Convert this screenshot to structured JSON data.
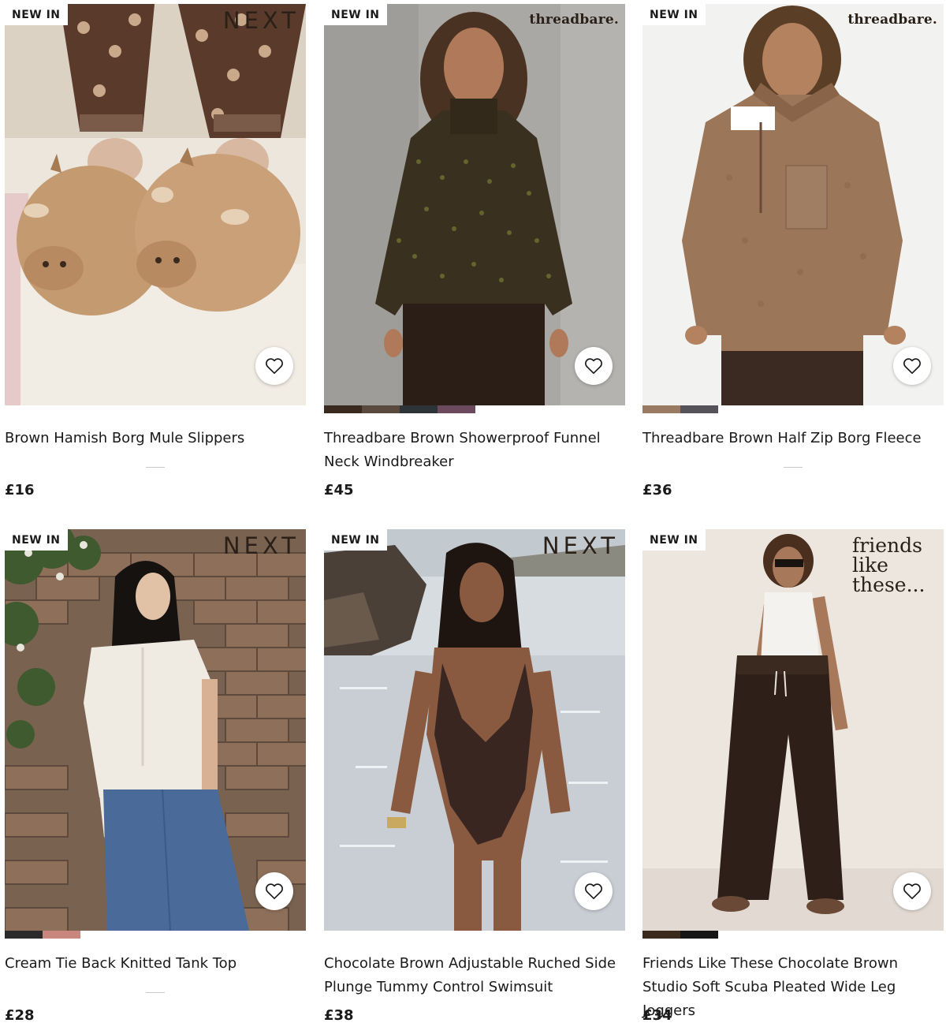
{
  "products": [
    {
      "badge": "NEW IN",
      "brand": "NEXT",
      "title": "Brown Hamish Borg Mule Slippers",
      "price": "£16",
      "image_desc_icon": "slippers-image",
      "swatches": []
    },
    {
      "badge": "NEW IN",
      "brand": "threadbare.",
      "title": "Threadbare Brown Showerproof Funnel Neck Windbreaker",
      "price": "£45",
      "image_desc_icon": "jacket-image",
      "swatches": [
        "#3a2a1e",
        "#5a4a3e",
        "#2c3438",
        "#6b4a5e"
      ]
    },
    {
      "badge": "NEW IN",
      "brand": "threadbare.",
      "title": "Threadbare Brown Half Zip Borg Fleece",
      "price": "£36",
      "image_desc_icon": "fleece-image",
      "swatches": [
        "#9a7a62",
        "#55525a"
      ]
    },
    {
      "badge": "NEW IN",
      "brand": "NEXT",
      "title": "Cream Tie Back Knitted Tank Top",
      "price": "£28",
      "image_desc_icon": "knit-top-image",
      "swatches": [
        "#2a2a2a",
        "#c9867e"
      ]
    },
    {
      "badge": "NEW IN",
      "brand": "NEXT",
      "title": "Chocolate Brown Adjustable Ruched Side Plunge Tummy Control Swimsuit",
      "price": "£38",
      "image_desc_icon": "swimsuit-image",
      "swatches": []
    },
    {
      "badge": "NEW IN",
      "brand": "friends like these...",
      "title": "Friends Like These Chocolate Brown Studio Soft Scuba Pleated Wide Leg Joggers",
      "price": "£34",
      "image_desc_icon": "joggers-image",
      "swatches": [
        "#3a2a1e",
        "#161616"
      ]
    }
  ],
  "colors": {
    "text": "#1a1a1a",
    "badge_bg": "#ffffff",
    "divider": "#c9c9c9"
  }
}
